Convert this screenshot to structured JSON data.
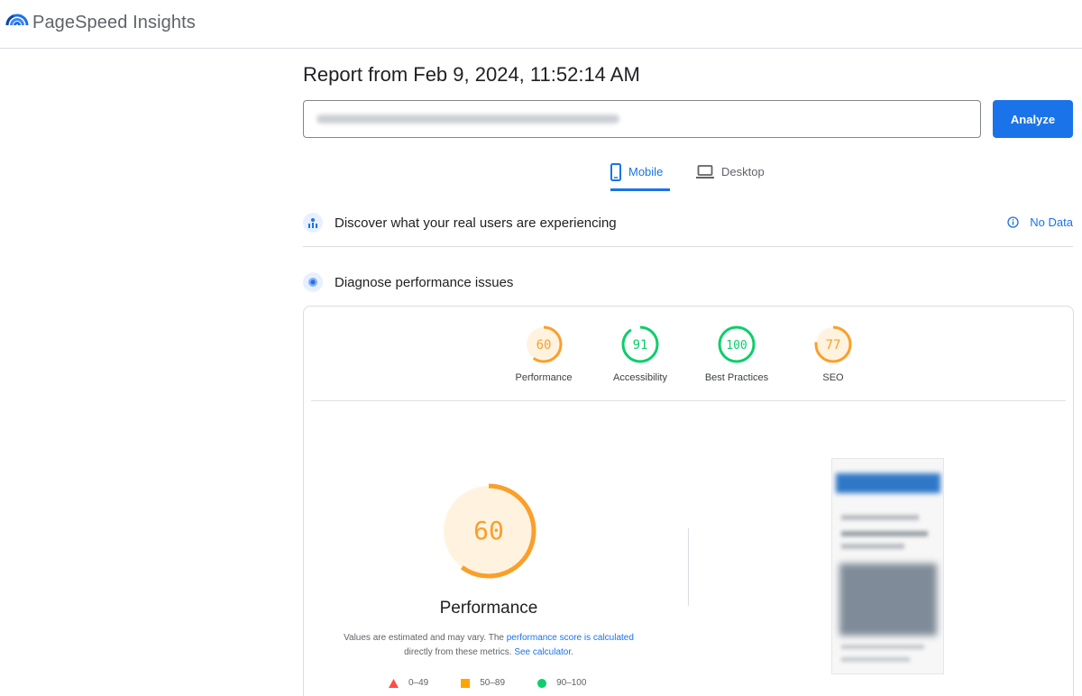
{
  "header": {
    "app_title": "PageSpeed Insights",
    "logo_icon": "pagespeed-logo-icon"
  },
  "report": {
    "title": "Report from Feb 9, 2024, 11:52:14 AM"
  },
  "url_input": {
    "value": "",
    "blurred": true
  },
  "actions": {
    "analyze_label": "Analyze"
  },
  "tabs": [
    {
      "label": "Mobile",
      "icon": "smartphone-icon",
      "active": true
    },
    {
      "label": "Desktop",
      "icon": "laptop-icon",
      "active": false
    }
  ],
  "field_data": {
    "heading": "Discover what your real users are experiencing",
    "icon": "users-chart-icon",
    "status": "No Data",
    "status_icon": "info-icon"
  },
  "lab_data": {
    "heading": "Diagnose performance issues",
    "icon": "lighthouse-icon"
  },
  "scores": [
    {
      "label": "Performance",
      "value": 60,
      "color": "#fa9f2a",
      "fill": "#fff3e0"
    },
    {
      "label": "Accessibility",
      "value": 91,
      "color": "#0cce6b",
      "fill": "#ffffff"
    },
    {
      "label": "Best Practices",
      "value": 100,
      "color": "#0cce6b",
      "fill": "#ffffff"
    },
    {
      "label": "SEO",
      "value": 77,
      "color": "#fa9f2a",
      "fill": "#fff3e0"
    }
  ],
  "performance_detail": {
    "score": "60",
    "title": "Performance",
    "desc_part1": "Values are estimated and may vary. The ",
    "desc_link1": "performance score is calculated",
    "desc_part2": "directly from these metrics. ",
    "desc_link2": "See calculator",
    "desc_end": "."
  },
  "legend": [
    {
      "range": "0–49",
      "shape": "triangle",
      "color": "#ff4e42"
    },
    {
      "range": "50–89",
      "shape": "square",
      "color": "#ffa400"
    },
    {
      "range": "90–100",
      "shape": "circle",
      "color": "#0cce6b"
    }
  ],
  "colors": {
    "accent": "#1a73e8",
    "pass": "#0cce6b",
    "average": "#fa9f2a",
    "fail": "#ff4e42"
  }
}
